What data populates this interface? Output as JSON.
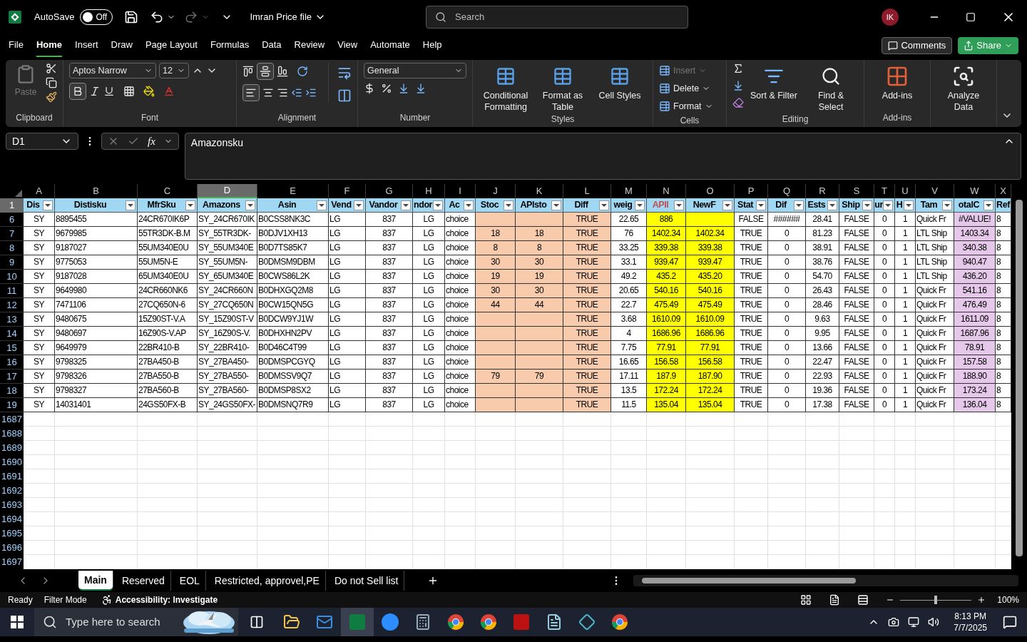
{
  "title_bar": {
    "autosave_label": "AutoSave",
    "autosave": {
      "on": false,
      "label": "Off"
    },
    "file_name": "Imran Price file",
    "search_placeholder": "Search",
    "avatar": "IK"
  },
  "menu_tabs": [
    {
      "label": "File",
      "selected": false
    },
    {
      "label": "Home",
      "selected": true
    },
    {
      "label": "Insert",
      "selected": false
    },
    {
      "label": "Draw",
      "selected": false
    },
    {
      "label": "Page Layout",
      "selected": false
    },
    {
      "label": "Formulas",
      "selected": false
    },
    {
      "label": "Data",
      "selected": false
    },
    {
      "label": "Review",
      "selected": false
    },
    {
      "label": "View",
      "selected": false
    },
    {
      "label": "Automate",
      "selected": false
    },
    {
      "label": "Help",
      "selected": false
    }
  ],
  "comments_button": "Comments",
  "share_button": "Share",
  "ribbon": {
    "clipboard": {
      "label": "Clipboard",
      "paste": {
        "label": "Paste",
        "disabled": true
      }
    },
    "font": {
      "label": "Font",
      "font_name": "Aptos Narrow",
      "font_size": "12",
      "bold": true
    },
    "alignment": {
      "label": "Alignment",
      "middle_align": true,
      "align_left": true
    },
    "number": {
      "label": "Number",
      "format": "General"
    },
    "styles": {
      "label": "Styles",
      "buttons": [
        "Conditional Formatting",
        "Format as Table",
        "Cell Styles"
      ]
    },
    "cells": {
      "label": "Cells",
      "buttons": [
        {
          "label": "Insert",
          "disabled": true
        },
        {
          "label": "Delete",
          "disabled": false
        },
        {
          "label": "Format",
          "disabled": false
        }
      ]
    },
    "editing": {
      "label": "Editing",
      "buttons": [
        "Sort & Filter",
        "Find & Select"
      ]
    },
    "addins": {
      "label": "Add-ins",
      "button": "Add-ins"
    },
    "analyze": {
      "button": "Analyze Data"
    }
  },
  "formula_bar": {
    "name_box": "D1",
    "fx": "fx",
    "value": "Amazonsku"
  },
  "columns": [
    {
      "letter": "A",
      "header": "Dis",
      "color": "#ffffff",
      "selected": false,
      "header_alert": false
    },
    {
      "letter": "B",
      "header": "Distisku",
      "color": "#ffffff",
      "selected": false,
      "header_alert": false
    },
    {
      "letter": "C",
      "header": "MfrSku",
      "color": "#ffffff",
      "selected": false,
      "header_alert": false
    },
    {
      "letter": "D",
      "header": "Amazons",
      "color": "#ffffff",
      "selected": true,
      "header_alert": false
    },
    {
      "letter": "E",
      "header": "Asin",
      "color": "#ffffff",
      "selected": false,
      "header_alert": false
    },
    {
      "letter": "F",
      "header": "Vend",
      "color": "#ffffff",
      "selected": false,
      "header_alert": false
    },
    {
      "letter": "G",
      "header": "Vandor",
      "color": "#ffffff",
      "selected": false,
      "header_alert": false
    },
    {
      "letter": "H",
      "header": "ndor",
      "color": "#ffffff",
      "selected": false,
      "header_alert": false
    },
    {
      "letter": "I",
      "header": "Ac",
      "color": "#ffffff",
      "selected": false,
      "header_alert": false
    },
    {
      "letter": "J",
      "header": "Stoc",
      "color": "#f8cbad",
      "selected": false,
      "header_alert": false
    },
    {
      "letter": "K",
      "header": "APIsto",
      "color": "#f8cbad",
      "selected": false,
      "header_alert": false
    },
    {
      "letter": "L",
      "header": "Diff",
      "color": "#f8cbad",
      "selected": false,
      "header_alert": false
    },
    {
      "letter": "M",
      "header": "weig",
      "color": "#ffffff",
      "selected": false,
      "header_alert": false
    },
    {
      "letter": "N",
      "header": "APII",
      "color": "#ffff00",
      "selected": false,
      "header_alert": true
    },
    {
      "letter": "O",
      "header": "NewF",
      "color": "#ffff00",
      "selected": false,
      "header_alert": false
    },
    {
      "letter": "P",
      "header": "Stat",
      "color": "#ffffff",
      "selected": false,
      "header_alert": false
    },
    {
      "letter": "Q",
      "header": "Dif",
      "color": "#ffffff",
      "selected": false,
      "header_alert": false
    },
    {
      "letter": "R",
      "header": "Ests",
      "color": "#ffffff",
      "selected": false,
      "header_alert": false
    },
    {
      "letter": "S",
      "header": "Ship",
      "color": "#ffffff",
      "selected": false,
      "header_alert": false
    },
    {
      "letter": "T",
      "header": "ur",
      "color": "#ffffff",
      "selected": false,
      "header_alert": false
    },
    {
      "letter": "U",
      "header": "H",
      "color": "#ffffff",
      "selected": false,
      "header_alert": false
    },
    {
      "letter": "V",
      "header": "Tam",
      "color": "#ffffff",
      "selected": false,
      "header_alert": false
    },
    {
      "letter": "W",
      "header": "otalC",
      "color": "#e6c8ea",
      "selected": false,
      "header_alert": false
    },
    {
      "letter": "X",
      "header": "Ref",
      "color": "#ffffff",
      "selected": false,
      "header_alert": false
    }
  ],
  "header_row": {
    "number": "1",
    "selected": true
  },
  "rows": [
    {
      "number": "6",
      "cells": [
        "SY",
        "8895455",
        "24CR670IK6P",
        "SY_24CR670IK",
        "B0CSS8NK3C",
        "LG",
        "837",
        "LG",
        "choice",
        "",
        "",
        "TRUE",
        "22.65",
        "886",
        "",
        "FALSE",
        "######",
        "28.41",
        "FALSE",
        "0",
        "1",
        "Quick Fr",
        "#VALUE!",
        "8"
      ]
    },
    {
      "number": "7",
      "cells": [
        "SY",
        "9679985",
        "55TR3DK-B.M",
        "SY_55TR3DK-",
        "B0DJV1XH13",
        "LG",
        "837",
        "LG",
        "choice",
        "18",
        "18",
        "TRUE",
        "76",
        "1402.34",
        "1402.34",
        "TRUE",
        "0",
        "81.23",
        "FALSE",
        "0",
        "1",
        "LTL Ship",
        "1403.34",
        "8"
      ]
    },
    {
      "number": "8",
      "cells": [
        "SY",
        "9187027",
        "55UM340E0U",
        "SY_55UM340E",
        "B0D7TS85K7",
        "LG",
        "837",
        "LG",
        "choice",
        "8",
        "8",
        "TRUE",
        "33.25",
        "339.38",
        "339.38",
        "TRUE",
        "0",
        "38.91",
        "FALSE",
        "0",
        "1",
        "LTL Ship",
        "340.38",
        "8"
      ]
    },
    {
      "number": "9",
      "cells": [
        "SY",
        "9775053",
        "55UM5N-E",
        "SY_55UM5N-",
        "B0DMSM9DBM",
        "LG",
        "837",
        "LG",
        "choice",
        "30",
        "30",
        "TRUE",
        "33.1",
        "939.47",
        "939.47",
        "TRUE",
        "0",
        "38.76",
        "FALSE",
        "0",
        "1",
        "LTL Ship",
        "940.47",
        "8"
      ]
    },
    {
      "number": "10",
      "cells": [
        "SY",
        "9187028",
        "65UM340E0U",
        "SY_65UM340E",
        "B0CWS86L2K",
        "LG",
        "837",
        "LG",
        "choice",
        "19",
        "19",
        "TRUE",
        "49.2",
        "435.2",
        "435.20",
        "TRUE",
        "0",
        "54.70",
        "FALSE",
        "0",
        "1",
        "LTL Ship",
        "436.20",
        "8"
      ]
    },
    {
      "number": "11",
      "cells": [
        "SY",
        "9649980",
        "24CR660NK6",
        "SY_24CR660N",
        "B0DHXGQ2M8",
        "LG",
        "837",
        "LG",
        "choice",
        "30",
        "30",
        "TRUE",
        "20.65",
        "540.16",
        "540.16",
        "TRUE",
        "0",
        "26.43",
        "FALSE",
        "0",
        "1",
        "Quick Fr",
        "541.16",
        "8"
      ]
    },
    {
      "number": "12",
      "cells": [
        "SY",
        "7471106",
        "27CQ650N-6",
        "SY_27CQ650N",
        "B0CW15QN5G",
        "LG",
        "837",
        "LG",
        "choice",
        "44",
        "44",
        "TRUE",
        "22.7",
        "475.49",
        "475.49",
        "TRUE",
        "0",
        "28.46",
        "FALSE",
        "0",
        "1",
        "Quick Fr",
        "476.49",
        "8"
      ]
    },
    {
      "number": "13",
      "cells": [
        "SY",
        "9480675",
        "15Z90ST-V.A",
        "SY_15Z90ST-V",
        "B0DCW9YJ1W",
        "LG",
        "837",
        "LG",
        "choice",
        "",
        "",
        "TRUE",
        "3.68",
        "1610.09",
        "1610.09",
        "TRUE",
        "0",
        "9.63",
        "FALSE",
        "0",
        "1",
        "Quick Fr",
        "1611.09",
        "8"
      ]
    },
    {
      "number": "14",
      "cells": [
        "SY",
        "9480697",
        "16Z90S-V.AP",
        "SY_16Z90S-V.",
        "B0DHXHN2PV",
        "LG",
        "837",
        "LG",
        "choice",
        "",
        "",
        "TRUE",
        "4",
        "1686.96",
        "1686.96",
        "TRUE",
        "0",
        "9.95",
        "FALSE",
        "0",
        "1",
        "Quick Fr",
        "1687.96",
        "8"
      ]
    },
    {
      "number": "15",
      "cells": [
        "SY",
        "9649979",
        "22BR410-B",
        "SY_22BR410-",
        "B0D46C4T99",
        "LG",
        "837",
        "LG",
        "choice",
        "",
        "",
        "TRUE",
        "7.75",
        "77.91",
        "77.91",
        "TRUE",
        "0",
        "13.66",
        "FALSE",
        "0",
        "1",
        "Quick Fr",
        "78.91",
        "8"
      ]
    },
    {
      "number": "16",
      "cells": [
        "SY",
        "9798325",
        "27BA450-B",
        "SY_27BA450-",
        "B0DMSPCGYQ",
        "LG",
        "837",
        "LG",
        "choice",
        "",
        "",
        "TRUE",
        "16.65",
        "156.58",
        "156.58",
        "TRUE",
        "0",
        "22.47",
        "FALSE",
        "0",
        "1",
        "Quick Fr",
        "157.58",
        "8"
      ]
    },
    {
      "number": "17",
      "cells": [
        "SY",
        "9798326",
        "27BA550-B",
        "SY_27BA550-",
        "B0DMSSV9Q7",
        "LG",
        "837",
        "LG",
        "choice",
        "79",
        "79",
        "TRUE",
        "17.11",
        "187.9",
        "187.90",
        "TRUE",
        "0",
        "22.93",
        "FALSE",
        "0",
        "1",
        "Quick Fr",
        "188.90",
        "8"
      ]
    },
    {
      "number": "18",
      "cells": [
        "SY",
        "9798327",
        "27BA560-B",
        "SY_27BA560-",
        "B0DMSP8SX2",
        "LG",
        "837",
        "LG",
        "choice",
        "",
        "",
        "TRUE",
        "13.5",
        "172.24",
        "172.24",
        "TRUE",
        "0",
        "19.36",
        "FALSE",
        "0",
        "1",
        "Quick Fr",
        "173.24",
        "8"
      ]
    },
    {
      "number": "19",
      "cells": [
        "SY",
        "14031401",
        "24GS50FX-B",
        "SY_24GS50FX-",
        "B0DMSNQ7R9",
        "LG",
        "837",
        "LG",
        "choice",
        "",
        "",
        "TRUE",
        "11.5",
        "135.04",
        "135.04",
        "TRUE",
        "0",
        "17.38",
        "FALSE",
        "0",
        "1",
        "Quick Fr",
        "136.04",
        "8"
      ]
    }
  ],
  "empty_rows": [
    "1687",
    "1688",
    "1689",
    "1690",
    "1691",
    "1692",
    "1693",
    "1694",
    "1695",
    "1696",
    "1697"
  ],
  "sheet_tabs": [
    {
      "label": "Main",
      "selected": true
    },
    {
      "label": "Reserved",
      "selected": false
    },
    {
      "label": "EOL",
      "selected": false
    },
    {
      "label": "Restricted, approvel,PE",
      "selected": false
    },
    {
      "label": "Do not Sell list",
      "selected": false
    }
  ],
  "status_bar": {
    "ready": "Ready",
    "mode": "Filter Mode",
    "accessibility": "Accessibility: Investigate",
    "zoom": {
      "level": 0.5,
      "label": "100%"
    }
  },
  "taskbar": {
    "search_placeholder": "Type here to search",
    "time": "8:13 PM",
    "date": "7/7/2025"
  }
}
